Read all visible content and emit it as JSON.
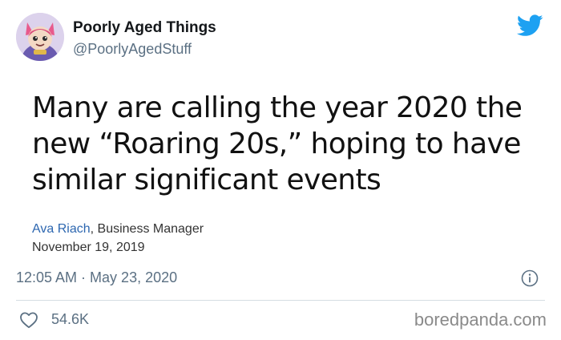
{
  "author": {
    "display_name": "Poorly Aged Things",
    "handle": "@PoorlyAgedStuff",
    "avatar_icon": "cartoon-character-avatar"
  },
  "platform_icon": "twitter-bird-icon",
  "tweet": {
    "text": "Many are calling the year 2020 the new “Roaring 20s,” hoping to have similar significant events",
    "attribution_name": "Ava Riach",
    "attribution_role": ", Business Manager",
    "attribution_date": "November 19, 2019",
    "timestamp": "12:05 AM · May 23, 2020",
    "likes": "54.6K"
  },
  "watermark": "boredpanda.com",
  "colors": {
    "twitter_blue": "#1da1f2",
    "secondary_text": "#5b7083",
    "link_blue": "#2d67b0"
  }
}
